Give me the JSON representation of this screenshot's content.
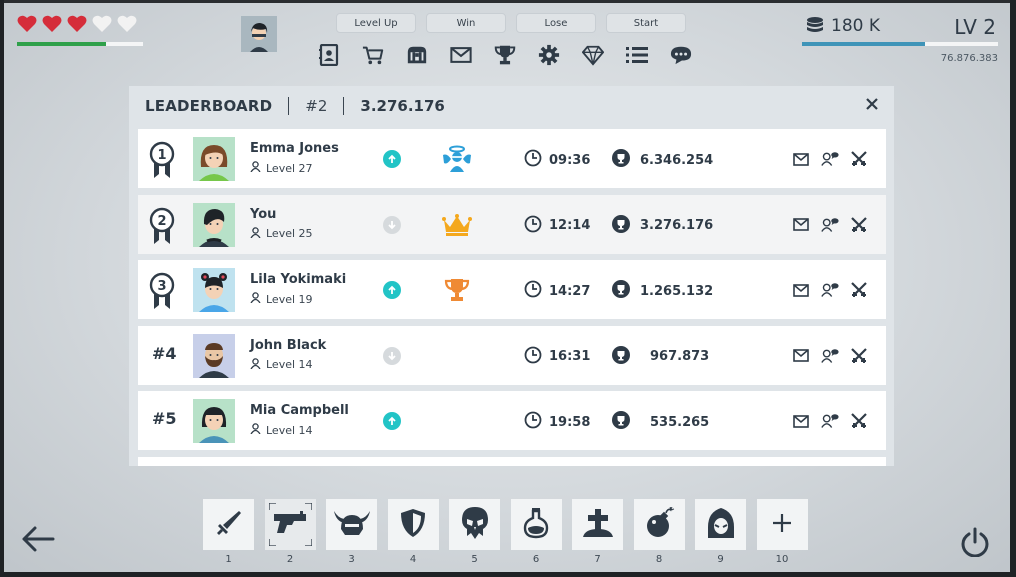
{
  "hud": {
    "hearts_total": 5,
    "hearts_full": 3,
    "health_fraction": 0.71,
    "coins": "180 K",
    "level": "LV 2",
    "xp_fraction": 0.63,
    "xp_value": "76.876.383"
  },
  "debug_buttons": [
    "Level Up",
    "Win",
    "Lose",
    "Start"
  ],
  "top_icons": [
    "contacts-icon",
    "cart-icon",
    "chest-icon",
    "mail-icon",
    "trophy-icon",
    "settings-icon",
    "diamond-icon",
    "list-icon",
    "chat-icon"
  ],
  "leaderboard": {
    "title": "LEADERBOARD",
    "rank": "#2",
    "score": "3.276.176",
    "rows": [
      {
        "rank": "1",
        "rank_style": "badge",
        "name": "Emma Jones",
        "level": "Level 27",
        "trend": "up",
        "award": "angel",
        "time": "09:36",
        "score": "6.346.254"
      },
      {
        "rank": "2",
        "rank_style": "badge",
        "name": "You",
        "level": "Level 25",
        "trend": "down",
        "award": "crown",
        "time": "12:14",
        "score": "3.276.176"
      },
      {
        "rank": "3",
        "rank_style": "badge",
        "name": "Lila Yokimaki",
        "level": "Level 19",
        "trend": "up",
        "award": "trophy",
        "time": "14:27",
        "score": "1.265.132"
      },
      {
        "rank": "#4",
        "rank_style": "text",
        "name": "John Black",
        "level": "Level 14",
        "trend": "down",
        "award": "",
        "time": "16:31",
        "score": "967.873"
      },
      {
        "rank": "#5",
        "rank_style": "text",
        "name": "Mia Campbell",
        "level": "Level 14",
        "trend": "up",
        "award": "",
        "time": "19:58",
        "score": "535.265"
      }
    ]
  },
  "toolbar": [
    {
      "num": "1",
      "icon": "sword-icon"
    },
    {
      "num": "2",
      "icon": "gun-icon"
    },
    {
      "num": "3",
      "icon": "viking-helmet-icon"
    },
    {
      "num": "4",
      "icon": "shield-icon"
    },
    {
      "num": "5",
      "icon": "skull-icon"
    },
    {
      "num": "6",
      "icon": "potion-icon"
    },
    {
      "num": "7",
      "icon": "grave-icon"
    },
    {
      "num": "8",
      "icon": "bomb-icon"
    },
    {
      "num": "9",
      "icon": "hood-icon"
    },
    {
      "num": "10",
      "icon": "plus-icon"
    }
  ],
  "colors": {
    "heart_full": "#d52d3a",
    "heart_empty": "#f2f2f2",
    "health": "#2fa04a",
    "xp": "#3f94b8",
    "trend_up": "#22c4c6",
    "trend_down": "#d6dadd",
    "dark": "#2f3b47"
  }
}
